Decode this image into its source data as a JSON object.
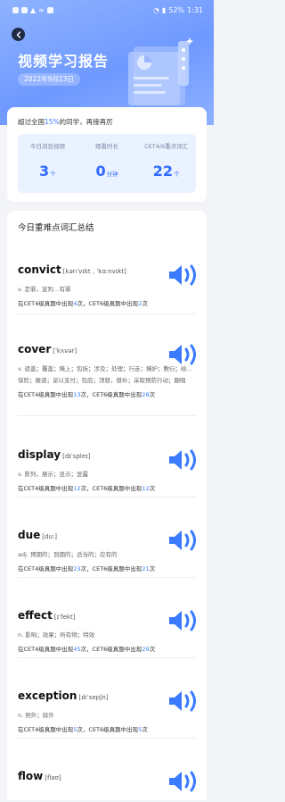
{
  "status": {
    "battery": "52%",
    "time": "1:31"
  },
  "header": {
    "title": "视频学习报告",
    "date": "2022年9月23日"
  },
  "summary": {
    "beat_prefix": "超过全国",
    "beat_pct": "15%",
    "beat_suffix": "的同学，再接再厉",
    "stats": [
      {
        "label": "今日浏览视频",
        "value": "3",
        "unit": "个"
      },
      {
        "label": "观看时长",
        "value": "0",
        "unit": "分钟"
      },
      {
        "label": "CET4/6重点词汇",
        "value": "22",
        "unit": "个"
      }
    ]
  },
  "words_section": {
    "title": "今日重难点词汇总结",
    "freq_prefix": "在CET4级真题中出现",
    "freq_mid": "次，CET6级真题中出现",
    "freq_suffix": "次",
    "items": [
      {
        "word": "convict",
        "phonetic": "[kənˈvɪkt , ˈkɑːnvɪkt]",
        "definition": "v. 定罪，宣判…有罪",
        "cet4": "4",
        "cet6": "2"
      },
      {
        "word": "cover",
        "phonetic": "[ˈkʌvər]",
        "definition": "v. 遮盖；覆盖；掩上；包括；涉及；处理；行走；掩护；敷衍；给…保险；报道；足以支付；包庇；顶替，替补；采取预防行动；翻唱",
        "cet4": "13",
        "cet6": "28"
      },
      {
        "word": "display",
        "phonetic": "[dɪˈspleɪ]",
        "definition": "v. 陈列，展示；显示；显露",
        "cet4": "12",
        "cet6": "12"
      },
      {
        "word": "due",
        "phonetic": "[duː]",
        "definition": "adj. 预期的；到期的；适当的；应有的",
        "cet4": "23",
        "cet6": "21"
      },
      {
        "word": "effect",
        "phonetic": "[ɪˈfekt]",
        "definition": "n. 影响；效果；所有物；特效",
        "cet4": "45",
        "cet6": "29"
      },
      {
        "word": "exception",
        "phonetic": "[ɪkˈsepʃn]",
        "definition": "n. 例外；除外",
        "cet4": "5",
        "cet6": "5"
      },
      {
        "word": "flow",
        "phonetic": "[flaʊ]"
      }
    ]
  },
  "colors": {
    "accent": "#3a7bff",
    "header_bg": "#7ea3ff"
  }
}
